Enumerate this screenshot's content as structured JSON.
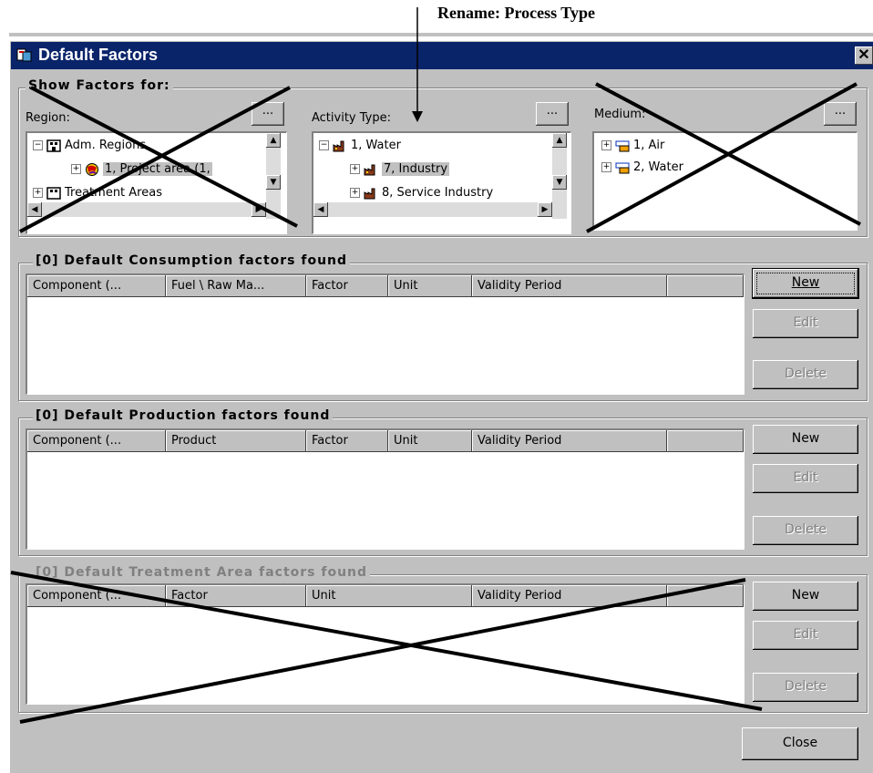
{
  "annotation": {
    "text": "Rename: Process Type"
  },
  "window": {
    "title": "Default Factors",
    "close_glyph": "✕"
  },
  "show_factors": {
    "label": "Show Factors for:",
    "region": {
      "label": "Region:",
      "button": "...",
      "items": [
        {
          "text": "Adm. Regions",
          "expander": "−",
          "icon": "building-icon"
        },
        {
          "text": "1, Project area (1,",
          "expander": "+",
          "icon": "globe-icon",
          "selected": true
        },
        {
          "text": "Treatment Areas",
          "expander": "+",
          "icon": "building-icon"
        }
      ]
    },
    "activity_type": {
      "label": "Activity Type:",
      "button": "...",
      "items": [
        {
          "text": "1, Water",
          "expander": "−",
          "icon": "factory-icon"
        },
        {
          "text": "7, Industry",
          "expander": "+",
          "icon": "factory-icon",
          "selected": true
        },
        {
          "text": "8, Service Industry",
          "expander": "+",
          "icon": "factory-icon"
        }
      ]
    },
    "medium": {
      "label": "Medium:",
      "button": "...",
      "items": [
        {
          "text": "1, Air",
          "expander": "+",
          "icon": "medium-icon"
        },
        {
          "text": "2, Water",
          "expander": "+",
          "icon": "medium-icon"
        }
      ]
    }
  },
  "consumption": {
    "label": "[0] Default Consumption factors found",
    "columns": [
      "Component (...",
      "Fuel \\ Raw Ma...",
      "Factor",
      "Unit",
      "Validity Period",
      ""
    ],
    "buttons": {
      "new": "New",
      "edit": "Edit",
      "delete": "Delete"
    }
  },
  "production": {
    "label": "[0] Default Production factors found",
    "columns": [
      "Component (...",
      "Product",
      "Factor",
      "Unit",
      "Validity Period",
      ""
    ],
    "buttons": {
      "new": "New",
      "edit": "Edit",
      "delete": "Delete"
    }
  },
  "treatment": {
    "label": "[0] Default Treatment Area factors found",
    "columns": [
      "Component (...",
      "Factor",
      "Unit",
      "Validity Period",
      ""
    ],
    "buttons": {
      "new": "New",
      "edit": "Edit",
      "delete": "Delete"
    }
  },
  "close_button": "Close",
  "colors": {
    "titlebar": "#0a246a",
    "face": "#c0c0c0",
    "shadow": "#808080",
    "disabled": "#808080"
  }
}
